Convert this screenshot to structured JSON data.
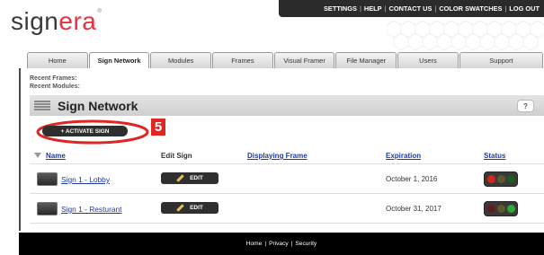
{
  "header": {
    "logo": {
      "prefix": "sign",
      "accent": "era",
      "trademark": "®"
    },
    "top_links": [
      "SETTINGS",
      "HELP",
      "CONTACT US",
      "COLOR SWATCHES",
      "LOG OUT"
    ],
    "separator": "|"
  },
  "tabs": [
    {
      "label": "Home",
      "active": false
    },
    {
      "label": "Sign Network",
      "active": true
    },
    {
      "label": "Modules",
      "active": false
    },
    {
      "label": "Frames",
      "active": false
    },
    {
      "label": "Visual Framer",
      "active": false
    },
    {
      "label": "File Manager",
      "active": false
    },
    {
      "label": "Users",
      "active": false
    },
    {
      "label": "Support",
      "active": false
    }
  ],
  "recent": {
    "frames_label": "Recent Frames:",
    "modules_label": "Recent Modules:"
  },
  "page": {
    "title": "Sign Network",
    "help_label": "?",
    "activate_button": "+ ACTIVATE SIGN",
    "step_badge": "5"
  },
  "table": {
    "headers": {
      "name": "Name",
      "edit": "Edit Sign",
      "frame": "Displaying Frame",
      "expiration": "Expiration",
      "status": "Status"
    },
    "rows": [
      {
        "name": "Sign 1 - Lobby",
        "edit_label": "EDIT",
        "displaying_frame": "",
        "expiration": "October 1, 2016",
        "status_light": "red"
      },
      {
        "name": "Sign 1 - Resturant",
        "edit_label": "EDIT",
        "displaying_frame": "",
        "expiration": "October 31, 2017",
        "status_light": "green"
      }
    ]
  },
  "footer": {
    "links": [
      "Home",
      "Privacy",
      "Security"
    ],
    "separator": "|"
  },
  "colors": {
    "brand_red": "#e8323a",
    "highlight_red": "#e02623",
    "link_blue": "#1f3aa6",
    "header_bar": "#2b2b2b",
    "footer_bar": "#000000"
  }
}
